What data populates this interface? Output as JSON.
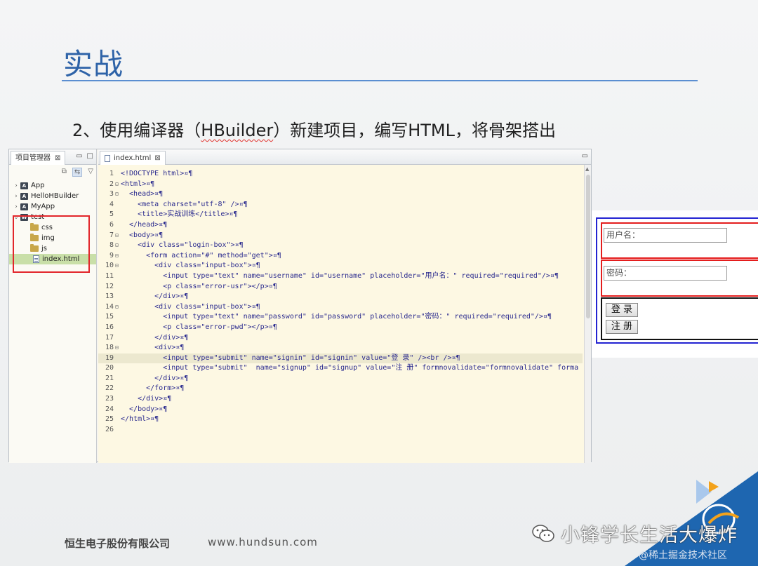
{
  "slide": {
    "title": "实战",
    "step_prefix": "2、使用编译器（",
    "step_hbuilder": "HBuilder",
    "step_suffix": "）新建项目，编写HTML，将骨架搭出"
  },
  "ide": {
    "explorer": {
      "tab_label": "项目管理器",
      "items": [
        {
          "label": "App",
          "expanded": false,
          "type": "project"
        },
        {
          "label": "HelloHBuilder",
          "expanded": false,
          "type": "project"
        },
        {
          "label": "MyApp",
          "expanded": false,
          "type": "project"
        },
        {
          "label": "test",
          "expanded": true,
          "type": "project"
        },
        {
          "label": "css",
          "type": "folder"
        },
        {
          "label": "img",
          "type": "folder"
        },
        {
          "label": "js",
          "type": "folder"
        },
        {
          "label": "index.html",
          "type": "file",
          "selected": true
        }
      ]
    },
    "editor": {
      "tab_label": "index.html",
      "highlighted_line": 19,
      "lines": [
        {
          "n": "1",
          "text": "<!DOCTYPE html>¤¶"
        },
        {
          "n": "2",
          "text": "<html>¤¶"
        },
        {
          "n": "3",
          "text": "  <head>¤¶"
        },
        {
          "n": "4",
          "text": "    <meta charset=\"utf-8\" />¤¶"
        },
        {
          "n": "5",
          "text": "    <title>实战训练</title>¤¶"
        },
        {
          "n": "6",
          "text": "  </head>¤¶"
        },
        {
          "n": "7",
          "text": "  <body>¤¶"
        },
        {
          "n": "8",
          "text": "    <div class=\"login-box\">¤¶"
        },
        {
          "n": "9",
          "text": "      <form action=\"#\" method=\"get\">¤¶"
        },
        {
          "n": "10",
          "text": "        <div class=\"input-box\">¤¶"
        },
        {
          "n": "11",
          "text": "          <input type=\"text\" name=\"username\" id=\"username\" placeholder=\"用户名：\" required=\"required\"/>¤¶"
        },
        {
          "n": "12",
          "text": "          <p class=\"error-usr\"></p>¤¶"
        },
        {
          "n": "13",
          "text": "        </div>¤¶"
        },
        {
          "n": "14",
          "text": "        <div class=\"input-box\">¤¶"
        },
        {
          "n": "15",
          "text": "          <input type=\"text\" name=\"password\" id=\"password\" placeholder=\"密码：\" required=\"required\"/>¤¶"
        },
        {
          "n": "16",
          "text": "          <p class=\"error-pwd\"></p>¤¶"
        },
        {
          "n": "17",
          "text": "        </div>¤¶"
        },
        {
          "n": "18",
          "text": "        <div>¤¶"
        },
        {
          "n": "19",
          "text": "          <input type=\"submit\" name=\"signin\" id=\"signin\" value=\"登 录\" /><br />¤¶"
        },
        {
          "n": "20",
          "text": "          <input type=\"submit\"  name=\"signup\" id=\"signup\" value=\"注 册\" formnovalidate=\"formnovalidate\" forma"
        },
        {
          "n": "21",
          "text": "        </div>¤¶"
        },
        {
          "n": "22",
          "text": "      </form>¤¶"
        },
        {
          "n": "23",
          "text": "    </div>¤¶"
        },
        {
          "n": "24",
          "text": "  </body>¤¶"
        },
        {
          "n": "25",
          "text": "</html>¤¶"
        },
        {
          "n": "26",
          "text": ""
        }
      ]
    }
  },
  "preview": {
    "username_placeholder": "用户名：",
    "password_placeholder": "密码：",
    "signin_label": "登 录",
    "signup_label": "注 册"
  },
  "footer": {
    "company": "恒生电子股份有限公司",
    "url": "www.hundsun.com"
  },
  "watermark": {
    "channel": "小锋学长生活大爆炸",
    "juejin": "@稀土掘金技术社区"
  },
  "colors": {
    "title": "#2e63a8",
    "corner": "#1e66b0",
    "box_red": "#e41d1d",
    "box_blue": "#2323d2"
  }
}
